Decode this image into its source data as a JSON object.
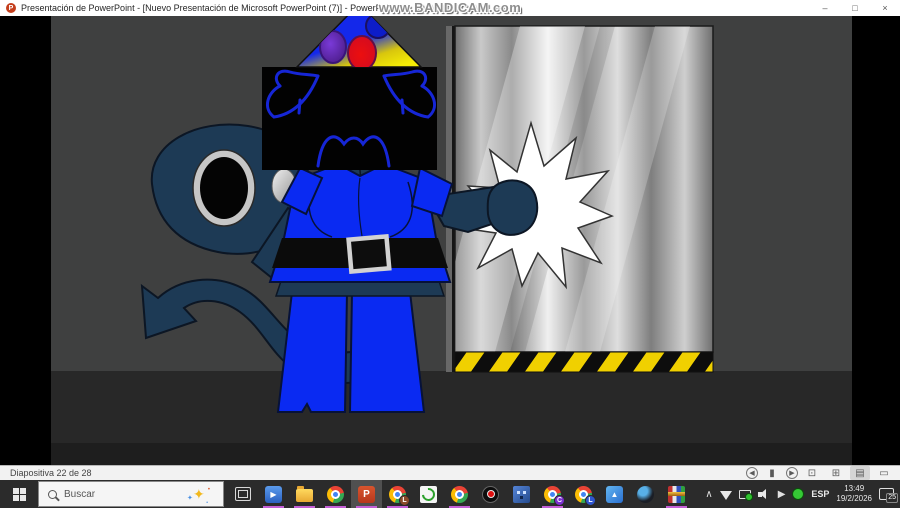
{
  "titlebar": {
    "app_icon_letter": "P",
    "title": "Presentación de PowerPoint - [Nuevo Presentación de Microsoft PowerPoint (7)] - PowerPoint",
    "minimize": "–",
    "restore": "□",
    "close": "×"
  },
  "watermark": {
    "text": "www.BANDICAM.com"
  },
  "slide": {
    "colors": {
      "wall": "#3f4040",
      "floor": "#282828",
      "letterbox": "#000000",
      "character_blue": "#0a2af2",
      "character_navy": "#1d3a55",
      "face_line_blue": "#1626d6",
      "hazard_yellow": "#f0d000",
      "hat_yellow": "#f4ec06",
      "impact_white": "#ffffff"
    }
  },
  "statusbar": {
    "slide_indicator": "Diapositiva 22 de 28",
    "icons": [
      {
        "name": "previous-slide-icon",
        "glyph": "◀",
        "circled": true,
        "active": false
      },
      {
        "name": "annotation-pen-icon",
        "glyph": "▮",
        "circled": false,
        "active": false
      },
      {
        "name": "next-slide-icon",
        "glyph": "▶",
        "circled": true,
        "active": false
      },
      {
        "name": "see-all-slides-icon",
        "glyph": "⊡",
        "circled": false,
        "active": false
      },
      {
        "name": "zoom-grid-icon",
        "glyph": "⊞",
        "circled": false,
        "active": false
      },
      {
        "name": "notes-icon",
        "glyph": "▤",
        "circled": false,
        "active": true
      },
      {
        "name": "monitor-icon",
        "glyph": "▭",
        "circled": false,
        "active": false
      }
    ]
  },
  "taskbar": {
    "search_placeholder": "Buscar",
    "running_indicator_color": "#c45fd6",
    "icons": [
      {
        "name": "task-view-icon",
        "type": "taskview",
        "glyph": "",
        "running": false,
        "active": false
      },
      {
        "name": "movies-tv-icon",
        "type": "media",
        "glyph": "▶",
        "running": true,
        "active": false
      },
      {
        "name": "file-explorer-icon",
        "type": "folder",
        "glyph": "",
        "running": true,
        "active": false
      },
      {
        "name": "chrome-icon",
        "type": "chrome",
        "glyph": "",
        "running": true,
        "active": false
      },
      {
        "name": "powerpoint-icon",
        "type": "ppt",
        "glyph": "P",
        "running": true,
        "active": true
      },
      {
        "name": "chrome-profile-l-icon",
        "type": "chrome",
        "glyph": "",
        "badge": "L",
        "badge_color": "#8a4a2a",
        "running": true,
        "active": false
      },
      {
        "name": "pivot-animator-icon",
        "type": "pivot",
        "glyph": "",
        "running": false,
        "active": false
      },
      {
        "name": "chrome-icon-2",
        "type": "chrome",
        "glyph": "",
        "running": true,
        "active": false
      },
      {
        "name": "bandicam-icon",
        "type": "bandicam",
        "glyph": "",
        "running": false,
        "active": false
      },
      {
        "name": "game-app-icon",
        "type": "game",
        "glyph": "",
        "running": false,
        "active": false
      },
      {
        "name": "chrome-profile-c-icon",
        "type": "chrome",
        "glyph": "",
        "badge": "C",
        "badge_color": "#7b2fd0",
        "running": true,
        "active": false
      },
      {
        "name": "chrome-profile-l2-icon",
        "type": "chrome",
        "glyph": "",
        "badge": "L",
        "badge_color": "#2f56d0",
        "running": false,
        "active": false
      },
      {
        "name": "photos-icon",
        "type": "photos",
        "glyph": "▲",
        "running": false,
        "active": false
      },
      {
        "name": "sphere-app-icon",
        "type": "sphere",
        "glyph": "",
        "running": false,
        "active": false
      },
      {
        "name": "winrar-icon",
        "type": "winrar",
        "glyph": "",
        "running": true,
        "active": false
      }
    ],
    "tray": {
      "chevron": "∧",
      "play": "▶",
      "language": "ESP",
      "time": "13:49",
      "date": "19/2/2026",
      "notification_count": "25"
    }
  }
}
